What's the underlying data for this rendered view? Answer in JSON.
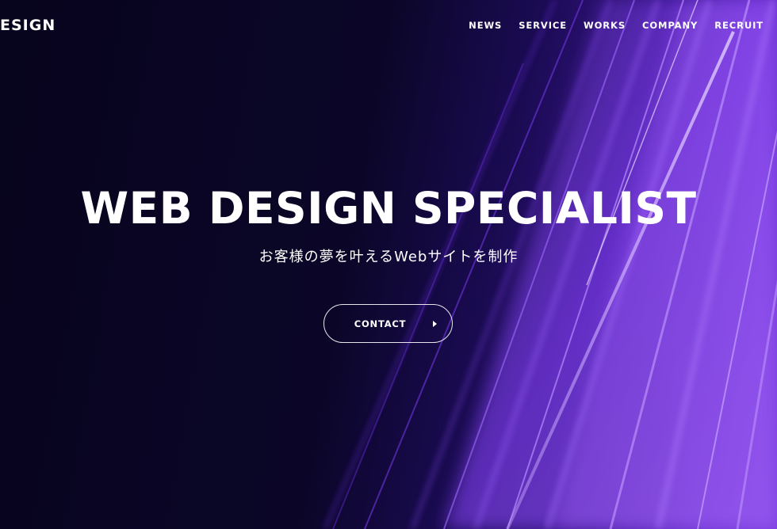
{
  "header": {
    "logo": "ESIGN",
    "nav": [
      "NEWS",
      "SERVICE",
      "WORKS",
      "COMPANY",
      "RECRUIT"
    ]
  },
  "hero": {
    "headline": "WEB DESIGN SPECIALIST",
    "subtitle": "お客様の夢を叶えるWebサイトを制作",
    "cta_label": "CONTACT",
    "cta_icon": "caret-right-icon"
  },
  "colors": {
    "background_dark": "#0a0624",
    "accent_purple": "#7a3ae0",
    "text": "#ffffff"
  }
}
